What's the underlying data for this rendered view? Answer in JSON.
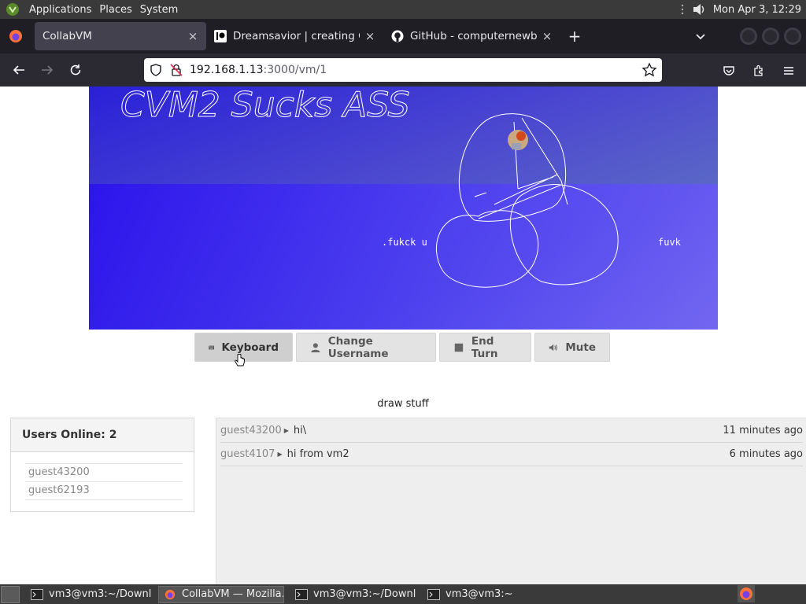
{
  "system_panel": {
    "menus": [
      "Applications",
      "Places",
      "System"
    ],
    "clock": "Mon Apr  3, 12:29"
  },
  "browser": {
    "tabs": [
      {
        "title": "CollabVM",
        "active": true,
        "icon": "firefox-icon"
      },
      {
        "title": "Dreamsavior | creating Gam",
        "active": false,
        "icon": "patreon-icon"
      },
      {
        "title": "GitHub - computernewb/coll",
        "active": false,
        "icon": "github-icon"
      }
    ],
    "url_host": "192.168.1.13",
    "url_path": ":3000/vm/1"
  },
  "vm_screen": {
    "drawn_text_1": "CVM2 Sucks ASS",
    "drawn_text_2": ".fukck u",
    "drawn_text_3": "fuvk"
  },
  "controls": {
    "keyboard": "Keyboard",
    "change_username": "Change Username",
    "end_turn": "End Turn",
    "mute": "Mute"
  },
  "vm_title": "draw stuff",
  "users": {
    "heading": "Users Online: 2",
    "list": [
      "guest43200",
      "guest62193"
    ]
  },
  "chat": [
    {
      "user": "guest43200",
      "message": "hi\\",
      "time": "11 minutes ago"
    },
    {
      "user": "guest4107",
      "message": "hi from vm2",
      "time": "6 minutes ago"
    }
  ],
  "taskbar": {
    "tasks": [
      {
        "label": "vm3@vm3:~/Downl…",
        "icon": "terminal-icon",
        "active": false
      },
      {
        "label": "CollabVM — Mozilla…",
        "icon": "firefox-icon",
        "active": true
      },
      {
        "label": "vm3@vm3:~/Downl…",
        "icon": "terminal-icon",
        "active": false
      },
      {
        "label": "vm3@vm3:~",
        "icon": "terminal-icon",
        "active": false
      }
    ]
  },
  "colors": {
    "vm_bg_start": "#2a20d8",
    "vm_bg_end": "#a3b6c9",
    "tab_strip": "#1f1e25",
    "nav_bar": "#2b2a33"
  }
}
